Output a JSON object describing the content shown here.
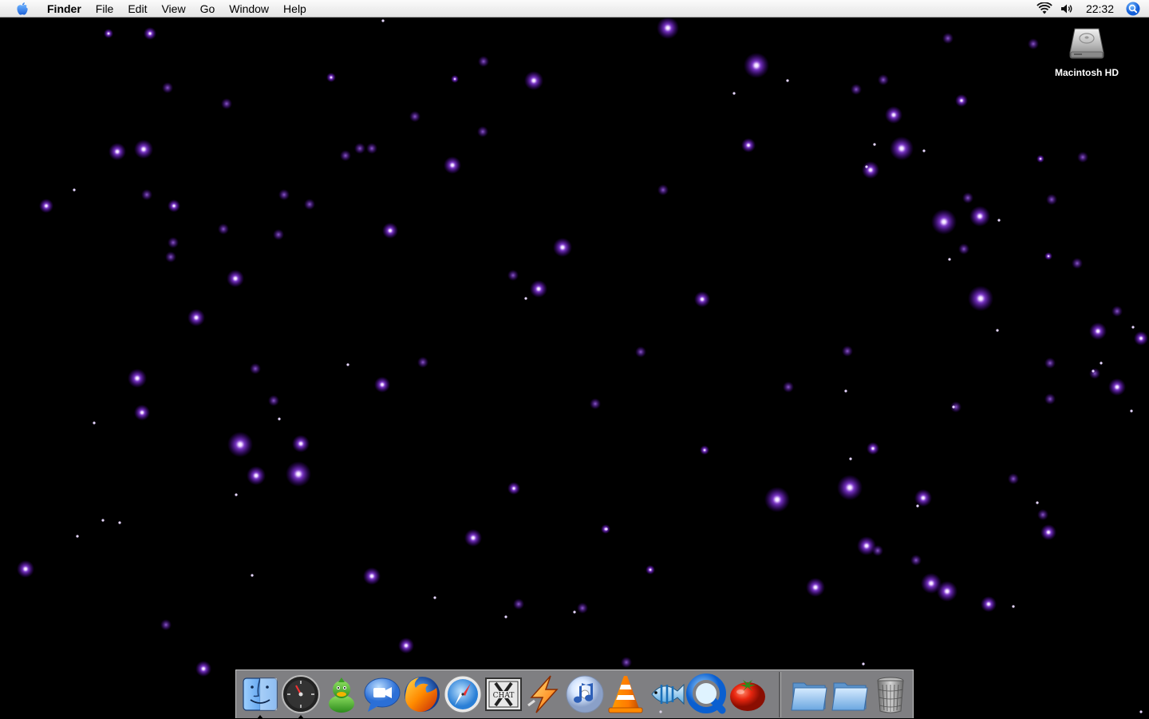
{
  "menubar": {
    "app_name": "Finder",
    "menus": [
      "File",
      "Edit",
      "View",
      "Go",
      "Window",
      "Help"
    ],
    "clock": "22:32"
  },
  "desktop": {
    "icons": [
      {
        "label": "Macintosh HD",
        "icon": "hard-drive-icon"
      }
    ]
  },
  "dock": {
    "apps": [
      {
        "name": "finder",
        "icon": "finder-icon",
        "running": true
      },
      {
        "name": "dashboard",
        "icon": "dashboard-icon",
        "running": true
      },
      {
        "name": "adium",
        "icon": "adium-duck-icon",
        "running": false
      },
      {
        "name": "ichat",
        "icon": "ichat-icon",
        "running": false
      },
      {
        "name": "firefox",
        "icon": "firefox-icon",
        "running": false
      },
      {
        "name": "safari",
        "icon": "safari-icon",
        "running": false
      },
      {
        "name": "x-chat",
        "icon": "xchat-icon",
        "running": false
      },
      {
        "name": "transmit",
        "icon": "lightning-icon",
        "running": false
      },
      {
        "name": "itunes",
        "icon": "itunes-icon",
        "running": false
      },
      {
        "name": "vlc",
        "icon": "vlc-cone-icon",
        "running": false
      },
      {
        "name": "fish",
        "icon": "fish-icon",
        "running": false
      },
      {
        "name": "quicktime",
        "icon": "quicktime-icon",
        "running": false
      },
      {
        "name": "tomato",
        "icon": "tomato-icon",
        "running": false
      }
    ],
    "stacks": [
      {
        "name": "folder-1",
        "icon": "folder-icon"
      },
      {
        "name": "folder-2",
        "icon": "folder-icon"
      },
      {
        "name": "trash",
        "icon": "trash-icon"
      }
    ]
  },
  "colors": {
    "star": "#a24bff",
    "menubar_top": "#fbfbfb",
    "menubar_bottom": "#e4e4e4"
  }
}
